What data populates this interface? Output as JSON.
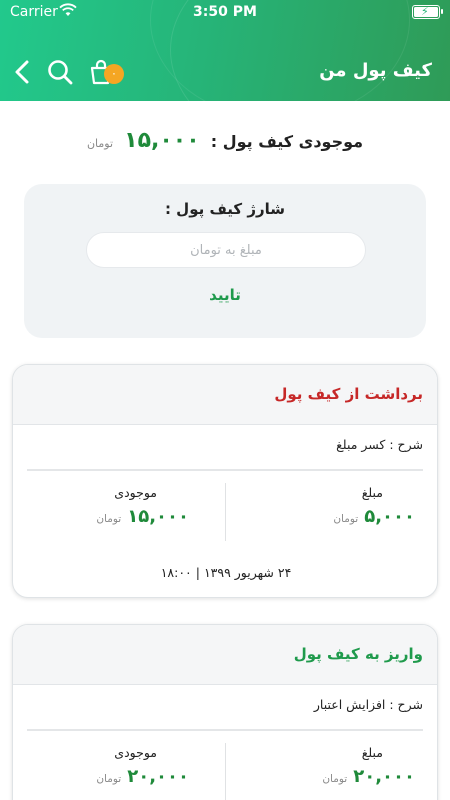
{
  "status_bar": {
    "carrier": "Carrier",
    "time": "3:50 PM"
  },
  "header": {
    "title": "کیف پول من",
    "cart_badge": "۰"
  },
  "balance": {
    "label": "موجودی کیف پول :",
    "amount": "۱۵,۰۰۰",
    "unit": "تومان"
  },
  "charge": {
    "title": "شارژ کیف پول :",
    "input_placeholder": "مبلغ به تومان",
    "input_value": "",
    "confirm_label": "تایید"
  },
  "transactions": [
    {
      "title": "برداشت از کیف پول",
      "title_color": "#c62828",
      "description": "شرح : کسر مبلغ",
      "amount_label": "مبلغ",
      "amount": "۵,۰۰۰",
      "amount_unit": "تومان",
      "balance_label": "موجودی",
      "balance": "۱۵,۰۰۰",
      "balance_unit": "تومان",
      "date": "۲۴ شهریور ۱۳۹۹ | ۱۸:۰۰"
    },
    {
      "title": "واریز به کیف پول",
      "title_color": "#1f9a4c",
      "description": "شرح : افزایش اعتبار",
      "amount_label": "مبلغ",
      "amount": "۲۰,۰۰۰",
      "amount_unit": "تومان",
      "balance_label": "موجودی",
      "balance": "۲۰,۰۰۰",
      "balance_unit": "تومان"
    }
  ],
  "colors": {
    "header_start": "#22c98c",
    "header_end": "#2f9b57",
    "accent_green": "#1f8a3a",
    "badge": "#f5a623",
    "withdraw_red": "#c62828"
  }
}
